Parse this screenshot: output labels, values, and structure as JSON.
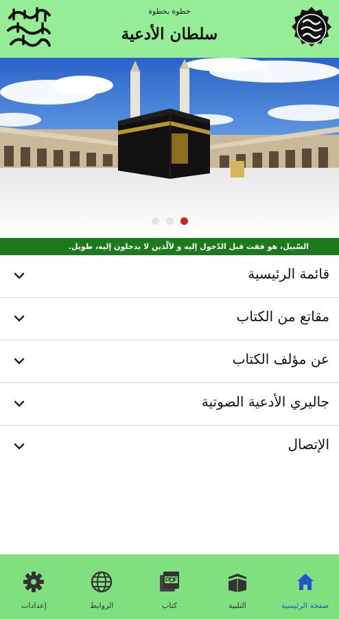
{
  "header": {
    "subtitle": "خطوة بخطوة",
    "title": "سلطان الأدعية",
    "logo_left": "صلى الله عليه وسلم",
    "logo_right": "محمد رسول الله"
  },
  "banner": {
    "image": "kaaba-mecca-photo",
    "slide_count": 3,
    "active_slide": 3
  },
  "ticker": {
    "text": "السّبيل، هو فقت قبل الدّخول إليه و لآلّذين لا يدخلون إليه، طويل."
  },
  "menu": {
    "items": [
      {
        "label": "قائمة الرئيسية"
      },
      {
        "label": "مقاتع من الكتاب"
      },
      {
        "label": "عن مؤلف الكتاب"
      },
      {
        "label": "جاليري الأدعية الصوتية"
      },
      {
        "label": "الإتصال"
      }
    ]
  },
  "bottom_nav": {
    "items": [
      {
        "label": "صفحة الرئيسية",
        "icon": "home-icon",
        "active": true
      },
      {
        "label": "التلبية",
        "icon": "kaaba-icon",
        "active": false
      },
      {
        "label": "كتاب",
        "icon": "pdf-icon",
        "active": false
      },
      {
        "label": "الروابط",
        "icon": "globe-icon",
        "active": false
      },
      {
        "label": "إعدادات",
        "icon": "gear-icon",
        "active": false
      }
    ]
  },
  "colors": {
    "header_bg": "#95ee95",
    "ticker_bg": "#1c7a1c",
    "nav_bg": "#80e080",
    "active_nav": "#2255cc",
    "active_dot": "#c62828"
  }
}
